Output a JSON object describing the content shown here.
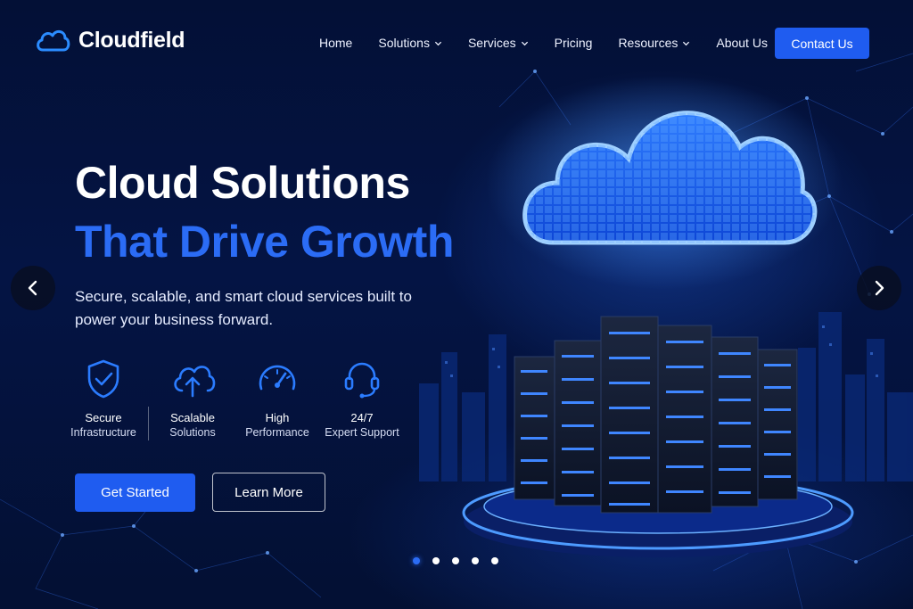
{
  "brand": {
    "name": "Cloudfield",
    "logo_icon": "cloud-icon",
    "accent": "#2b6cf5"
  },
  "nav": {
    "items": [
      {
        "label": "Home",
        "has_dropdown": false
      },
      {
        "label": "Solutions",
        "has_dropdown": true
      },
      {
        "label": "Services",
        "has_dropdown": true
      },
      {
        "label": "Pricing",
        "has_dropdown": false
      },
      {
        "label": "Resources",
        "has_dropdown": true
      },
      {
        "label": "About Us",
        "has_dropdown": false
      }
    ],
    "cta_label": "Contact Us"
  },
  "hero": {
    "title_line1": "Cloud Solutions",
    "title_line2": "That Drive Growth",
    "description": "Secure, scalable, and smart cloud services built to power your business forward.",
    "features": [
      {
        "icon": "shield-check-icon",
        "line1": "Secure",
        "line2": "Infrastructure"
      },
      {
        "icon": "cloud-upload-icon",
        "line1": "Scalable",
        "line2": "Solutions"
      },
      {
        "icon": "speedometer-icon",
        "line1": "High",
        "line2": "Performance"
      },
      {
        "icon": "headset-icon",
        "line1": "24/7",
        "line2": "Expert Support"
      }
    ],
    "primary_button": "Get Started",
    "secondary_button": "Learn More"
  },
  "carousel": {
    "prev_icon": "chevron-left-icon",
    "next_icon": "chevron-right-icon",
    "slide_count": 5,
    "active_slide": 1
  },
  "illustration": {
    "subject": "cloud-server-illustration"
  }
}
